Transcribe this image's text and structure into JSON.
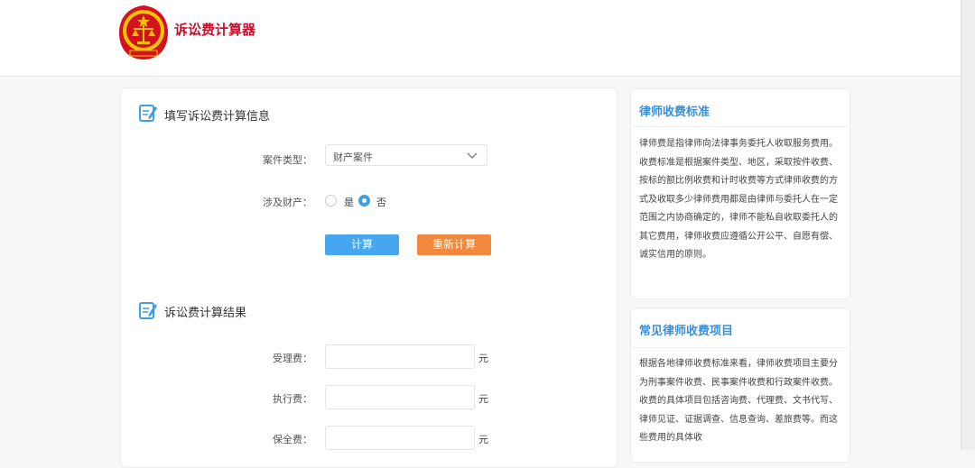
{
  "header": {
    "logo_icon": "court-emblem-icon",
    "title": "诉讼费计算器"
  },
  "input_section": {
    "icon": "edit-form-icon",
    "title": "填写诉讼费计算信息",
    "case_type_label": "案件类型：",
    "case_type_value": "财产案件",
    "property_label": "涉及财产：",
    "option_yes": "是",
    "option_no": "否",
    "selected": "否",
    "calc_button": "计算",
    "reset_button": "重新计算"
  },
  "result_section": {
    "icon": "edit-form-icon",
    "title": "诉讼费计算结果",
    "fields": [
      {
        "label": "受理费：",
        "unit": "元",
        "value": ""
      },
      {
        "label": "执行费：",
        "unit": "元",
        "value": ""
      },
      {
        "label": "保全费：",
        "unit": "元",
        "value": ""
      }
    ]
  },
  "sidebar": {
    "card1_title": "律师收费标准",
    "card1_text": "律师费是指律师向法律事务委托人收取服务费用。收费标准是根据案件类型、地区，采取按件收费、按标的额比例收费和计时收费等方式律师收费的方式及收取多少律师费用都是由律师与委托人在一定范围之内协商确定的，律师不能私自收取委托人的其它费用，律师收费应遵循公开公平、自愿有偿、诚实信用的原则。",
    "card2_title": "常见律师收费项目",
    "card2_text": "根据各地律师收费标准来看，律师收费项目主要分为刑事案件收费、民事案件收费和行政案件收费。收费的具体项目包括咨询费、代理费、文书代写、律师见证、证据调查、信息查询、差旅费等。而这些费用的具体收"
  },
  "colors": {
    "accent_blue": "#46a7ee",
    "accent_orange": "#f0883d",
    "brand_red": "#c8102e",
    "side_title_blue": "#3a8fd8"
  }
}
